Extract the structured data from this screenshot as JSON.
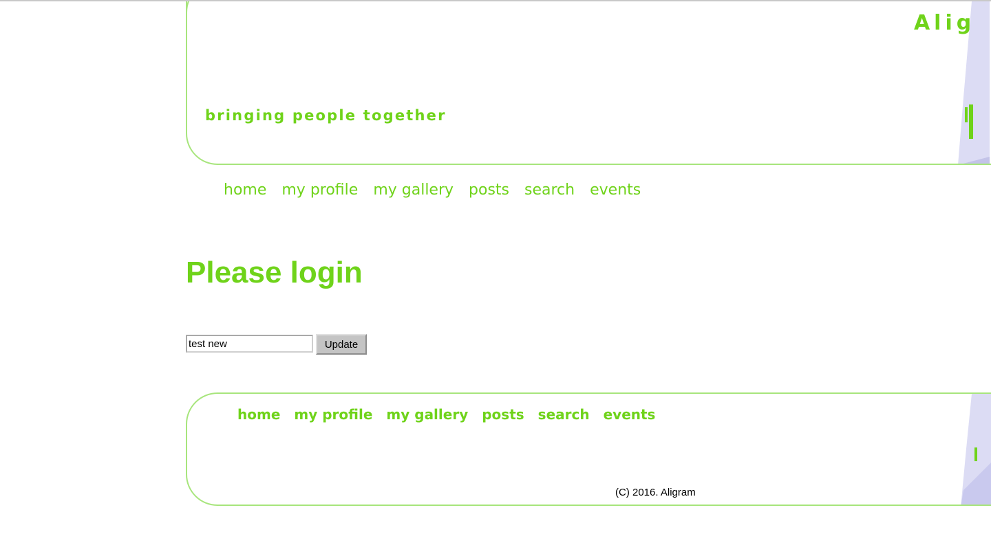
{
  "header": {
    "site_title": "Aligr",
    "tagline": "bringing people together"
  },
  "nav": {
    "items": [
      {
        "label": "home"
      },
      {
        "label": "my profile"
      },
      {
        "label": "my gallery"
      },
      {
        "label": "posts"
      },
      {
        "label": "search"
      },
      {
        "label": "events"
      }
    ]
  },
  "main": {
    "title": "Please login",
    "login_input_value": "test new",
    "update_button_label": "Update"
  },
  "footer": {
    "nav_items": [
      {
        "label": "home"
      },
      {
        "label": "my profile"
      },
      {
        "label": "my gallery"
      },
      {
        "label": "posts"
      },
      {
        "label": "search"
      },
      {
        "label": "events"
      }
    ],
    "copyright": "(C) 2016. Aligram"
  },
  "colors": {
    "accent": "#6fd31a",
    "border": "#a7e57c",
    "graphic": "#dcdcf4"
  }
}
